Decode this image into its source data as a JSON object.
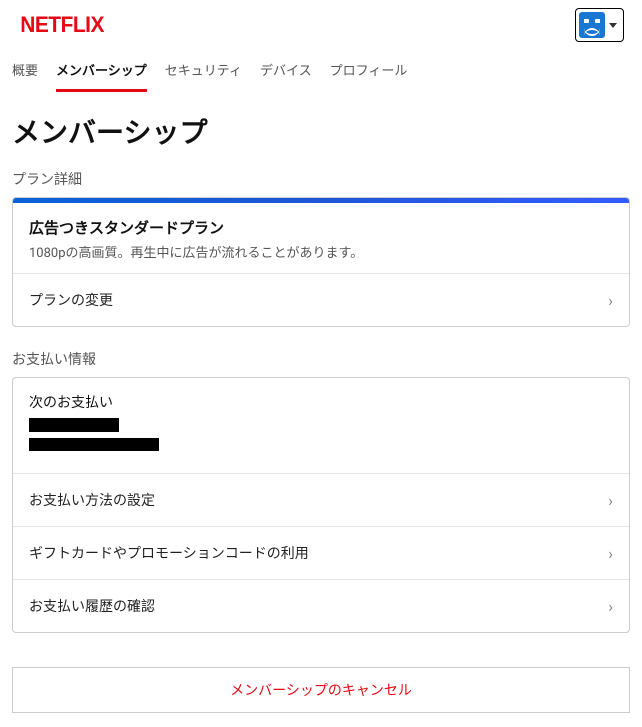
{
  "logo": "NETFLIX",
  "tabs": {
    "overview": "概要",
    "membership": "メンバーシップ",
    "security": "セキュリティ",
    "devices": "デバイス",
    "profile": "プロフィール"
  },
  "page_title": "メンバーシップ",
  "plan_section": {
    "label": "プラン詳細",
    "name": "広告つきスタンダードプラン",
    "desc": "1080pの高画質。再生中に広告が流れることがあります。",
    "change": "プランの変更"
  },
  "payment_section": {
    "label": "お支払い情報",
    "next_label": "次のお支払い",
    "manage_method": "お支払い方法の設定",
    "gift_promo": "ギフトカードやプロモーションコードの利用",
    "history": "お支払い履歴の確認"
  },
  "cancel": "メンバーシップのキャンセル"
}
